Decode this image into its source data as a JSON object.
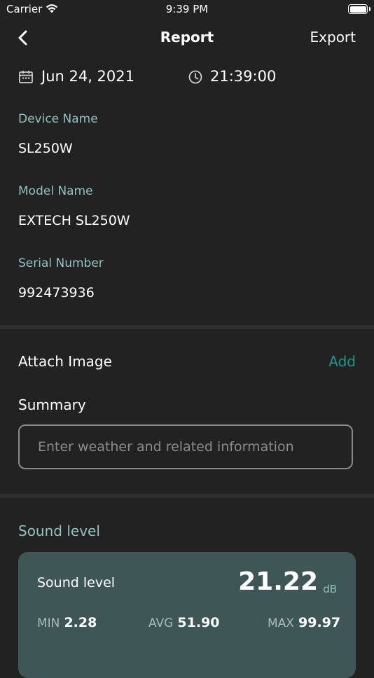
{
  "status": {
    "carrier": "Carrier",
    "time": "9:39 PM"
  },
  "nav": {
    "title": "Report",
    "export": "Export"
  },
  "datetime": {
    "date": "Jun 24, 2021",
    "time": "21:39:00"
  },
  "device": {
    "device_name_label": "Device Name",
    "device_name": "SL250W",
    "model_name_label": "Model Name",
    "model_name": "EXTECH SL250W",
    "serial_label": "Serial Number",
    "serial": "992473936"
  },
  "attach": {
    "label": "Attach Image",
    "add": "Add"
  },
  "summary": {
    "label": "Summary",
    "placeholder": "Enter weather and related information"
  },
  "sound": {
    "section_label": "Sound level",
    "card_title": "Sound level",
    "value": "21.22",
    "unit": "dB",
    "min_label": "MIN",
    "min": "2.28",
    "avg_label": "AVG",
    "avg": "51.90",
    "max_label": "MAX",
    "max": "99.97"
  },
  "colors": {
    "background": "#222222",
    "accent": "#1a9a8a",
    "label": "#8fc3c0",
    "card": "#3f5657"
  }
}
